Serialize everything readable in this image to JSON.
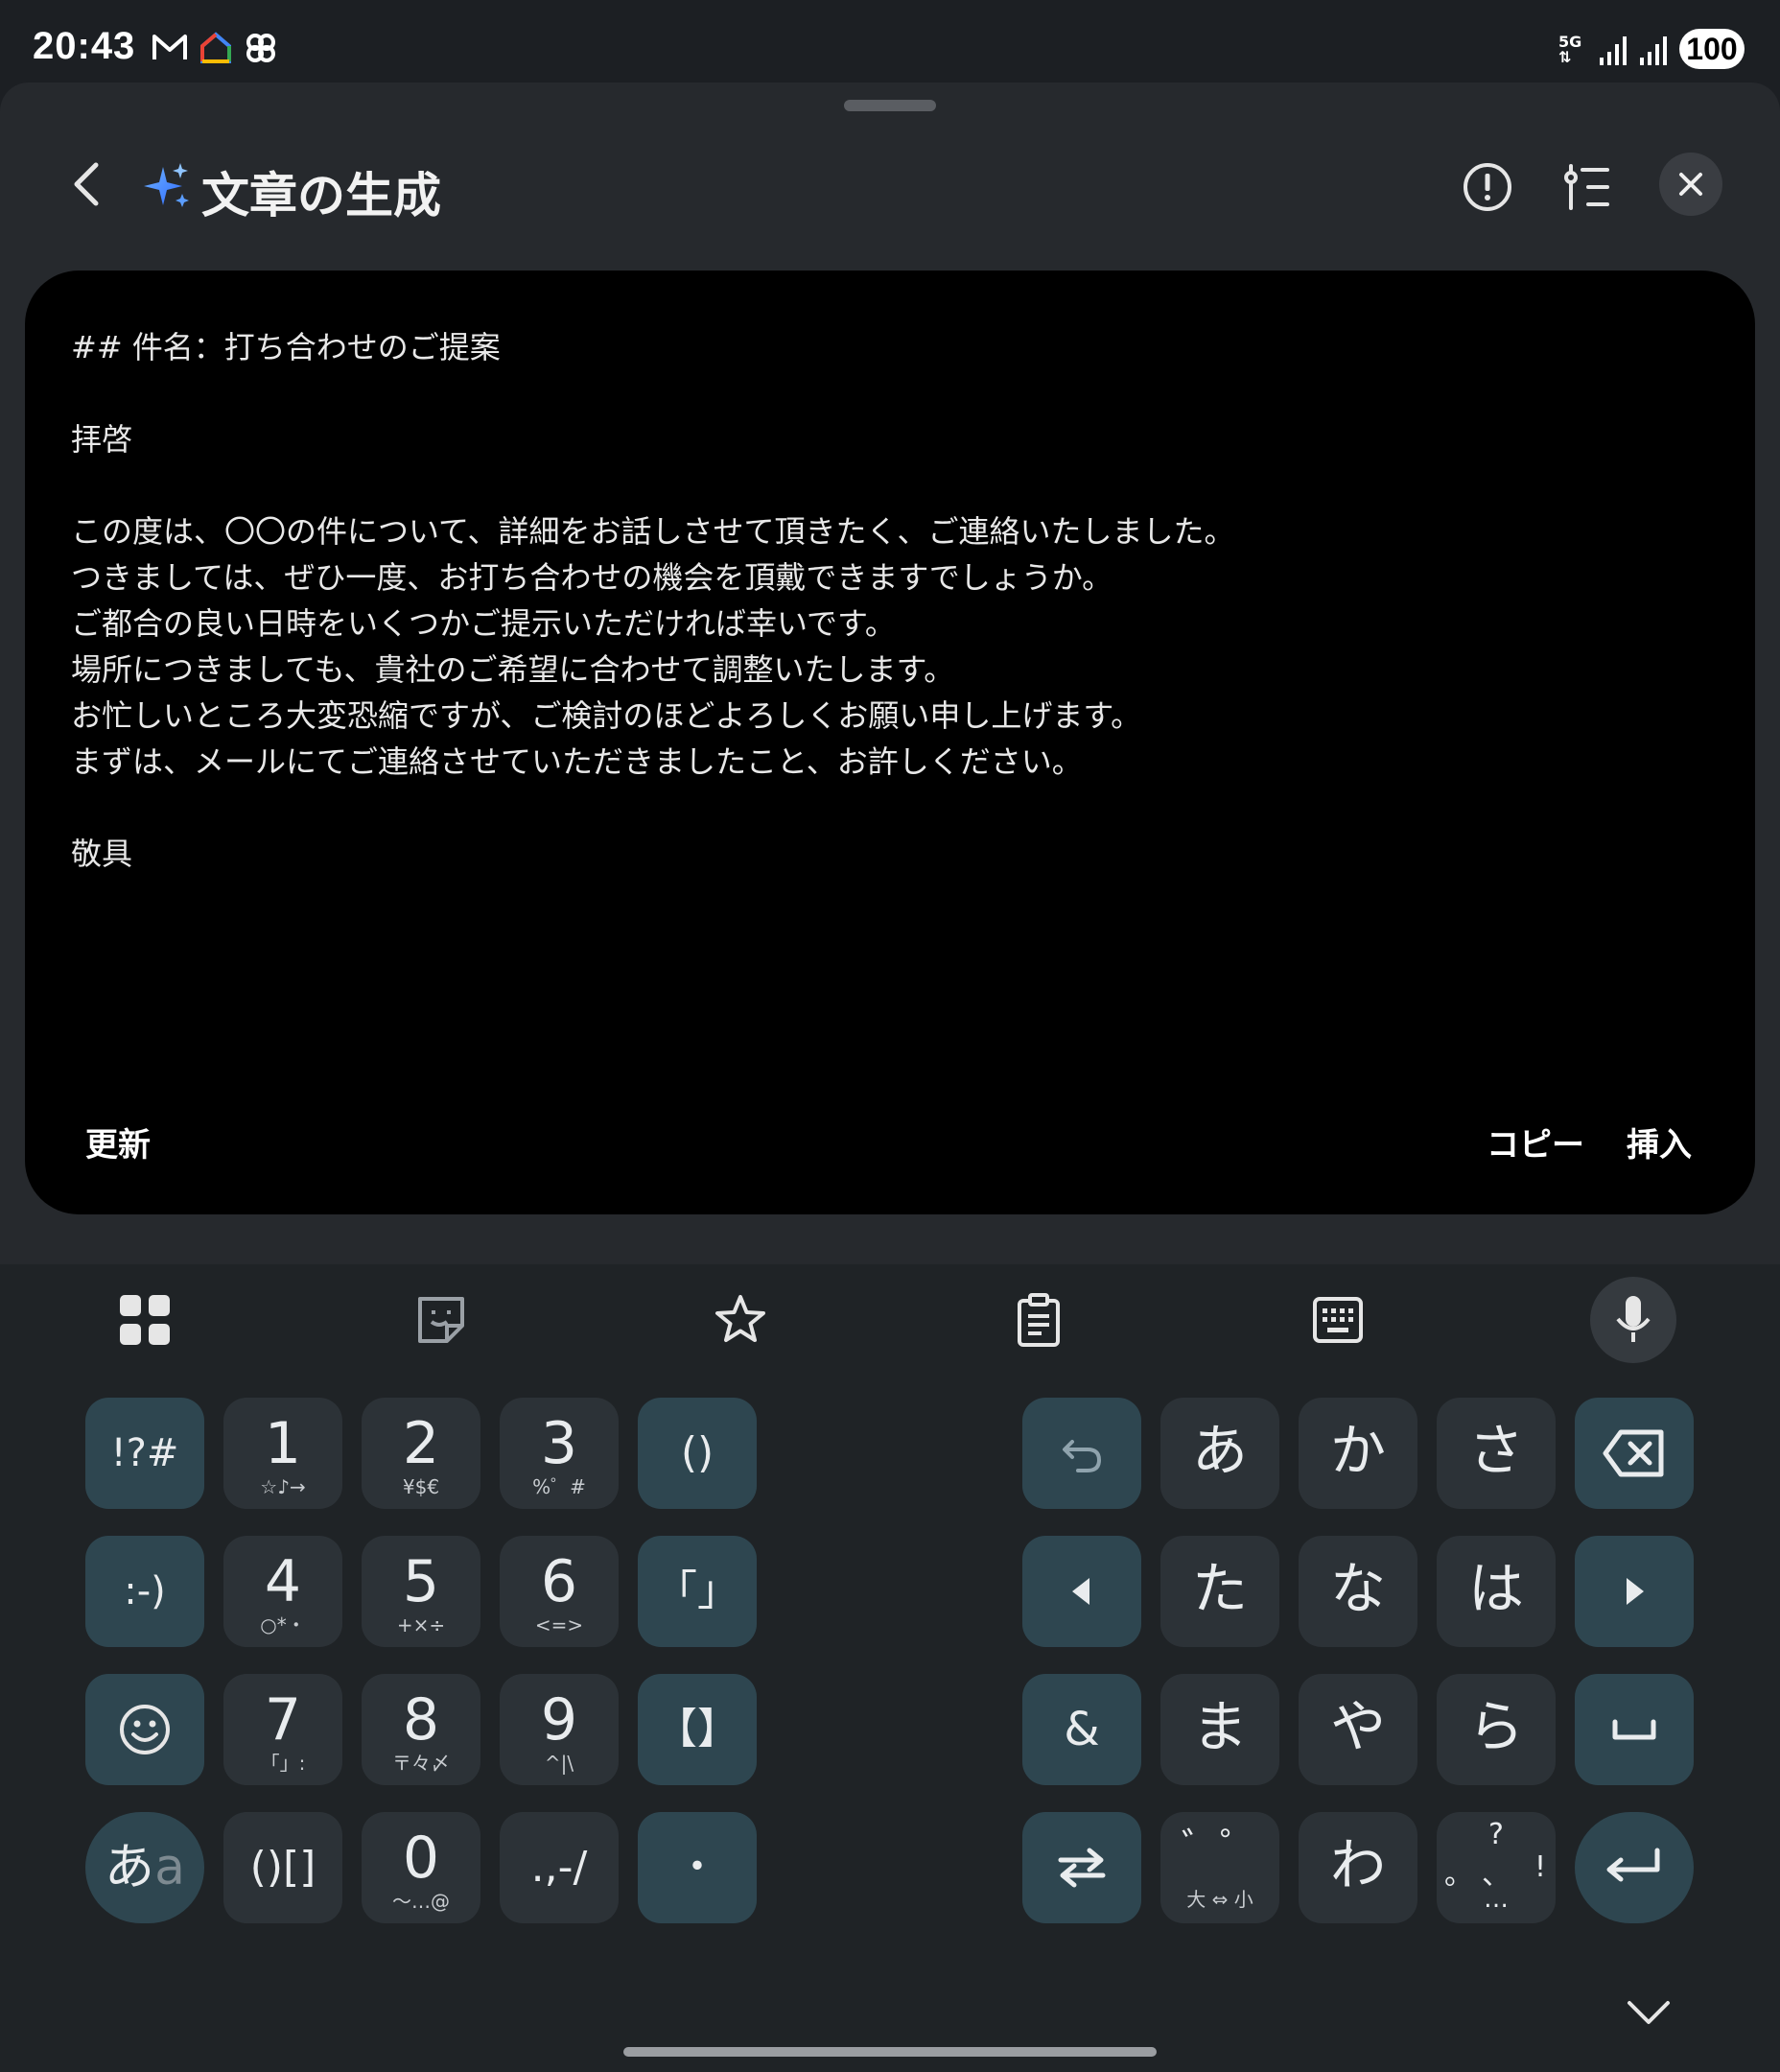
{
  "status_bar": {
    "time": "20:43",
    "left_icons": [
      "gmail-icon",
      "google-home-icon",
      "pinwheel-icon"
    ],
    "network_label": "5G",
    "battery": "100"
  },
  "header": {
    "title": "文章の生成",
    "icons": [
      "back-icon",
      "sparkle-icon",
      "info-icon",
      "tone-settings-icon",
      "close-icon"
    ]
  },
  "generated_text": {
    "lines": [
      "## 件名：打ち合わせのご提案",
      "拝啓",
      "この度は、〇〇の件について、詳細をお話しさせて頂きたく、ご連絡いたしました。",
      "つきましては、ぜひ一度、お打ち合わせの機会を頂戴できますでしょうか。",
      "ご都合の良い日時をいくつかご提示いただければ幸いです。",
      "場所につきましても、貴社のご希望に合わせて調整いたします。",
      "お忙しいところ大変恐縮ですが、ご検討のほどよろしくお願い申し上げます。",
      "まずは、メールにてご連絡させていただきましたこと、お許しください。",
      "敬具"
    ]
  },
  "actions": {
    "refresh": "更新",
    "copy": "コピー",
    "insert": "挿入"
  },
  "keyboard": {
    "toolbar": [
      "apps-grid-icon",
      "sticker-icon",
      "favorites-star-icon",
      "clipboard-icon",
      "keyboard-mode-icon",
      "mic-icon"
    ],
    "left": {
      "symbols": "!?#",
      "emoticon": ":-)",
      "brackets_a": "()",
      "brackets_b": "「」",
      "brackets_c": "【】",
      "paren_bracket": "()[]",
      "punct": ".,-/",
      "dot": "・",
      "mode_kana": "あ",
      "mode_latin": "a",
      "digits": [
        {
          "n": "1",
          "sub": "☆♪→"
        },
        {
          "n": "2",
          "sub": "¥$€"
        },
        {
          "n": "3",
          "sub": "%゜#"
        },
        {
          "n": "4",
          "sub": "○*・"
        },
        {
          "n": "5",
          "sub": "+×÷"
        },
        {
          "n": "6",
          "sub": "<=>"
        },
        {
          "n": "7",
          "sub": "「」:"
        },
        {
          "n": "8",
          "sub": "〒々〆"
        },
        {
          "n": "9",
          "sub": "^|\\"
        },
        {
          "n": "0",
          "sub": "〜…@"
        }
      ]
    },
    "right": {
      "kana": [
        "あ",
        "か",
        "さ",
        "た",
        "な",
        "は",
        "ま",
        "や",
        "ら",
        "わ"
      ],
      "ampersand": "&",
      "dakuten_top": "゛゜",
      "dakuten_sub": "大 ⇔ 小",
      "punct_top": "?",
      "punct_left": "。",
      "punct_right": "!",
      "punct_mid": "、",
      "punct_bottom": "…"
    }
  }
}
